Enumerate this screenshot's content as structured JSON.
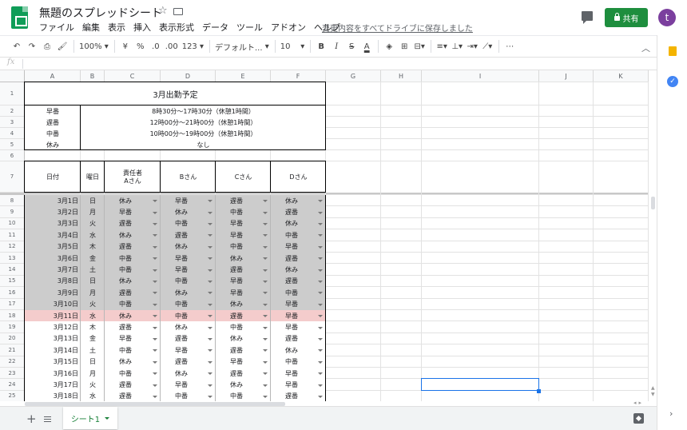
{
  "app": {
    "title": "無題のスプレッドシート",
    "save_status": "変更内容をすべてドライブに保存しました",
    "share_label": "共有",
    "avatar_letter": "t"
  },
  "menu": [
    "ファイル",
    "編集",
    "表示",
    "挿入",
    "表示形式",
    "データ",
    "ツール",
    "アドオン",
    "ヘルプ"
  ],
  "toolbar": {
    "zoom": "100%",
    "currency": "¥",
    "percent": "%",
    "dec_less": ".0",
    "dec_more": ".00",
    "more_formats": "123",
    "font": "デフォルト...",
    "font_size": "10",
    "bold": "B",
    "italic": "I",
    "strike": "S",
    "text_color": "A"
  },
  "formula_bar": {
    "fx": "fx",
    "value": ""
  },
  "columns": [
    "A",
    "B",
    "C",
    "D",
    "E",
    "F",
    "G",
    "H",
    "I",
    "J",
    "K"
  ],
  "rows": [
    "1",
    "2",
    "3",
    "4",
    "5",
    "6",
    "7",
    "8",
    "9",
    "10",
    "11",
    "12",
    "13",
    "14",
    "15",
    "16",
    "17",
    "18",
    "19",
    "20",
    "21",
    "22",
    "23",
    "24",
    "25"
  ],
  "sheet": {
    "title": "3月出勤予定",
    "shifts": [
      {
        "name": "早番",
        "time": "8時30分～17時30分（休憩1時間）"
      },
      {
        "name": "遅番",
        "time": "12時00分～21時00分（休憩1時間）"
      },
      {
        "name": "中番",
        "time": "10時00分～19時00分（休憩1時間）"
      },
      {
        "name": "休み",
        "time": "なし"
      }
    ],
    "headers": [
      "日付",
      "曜日",
      "責任者\nAさん",
      "Bさん",
      "Cさん",
      "Dさん"
    ],
    "schedule": [
      {
        "date": "3月1日",
        "day": "日",
        "a": "休み",
        "b": "早番",
        "c": "遅番",
        "d": "休み"
      },
      {
        "date": "3月2日",
        "day": "月",
        "a": "早番",
        "b": "休み",
        "c": "中番",
        "d": "遅番"
      },
      {
        "date": "3月3日",
        "day": "火",
        "a": "遅番",
        "b": "中番",
        "c": "早番",
        "d": "休み"
      },
      {
        "date": "3月4日",
        "day": "水",
        "a": "休み",
        "b": "遅番",
        "c": "早番",
        "d": "中番"
      },
      {
        "date": "3月5日",
        "day": "木",
        "a": "遅番",
        "b": "休み",
        "c": "中番",
        "d": "早番"
      },
      {
        "date": "3月6日",
        "day": "金",
        "a": "中番",
        "b": "早番",
        "c": "休み",
        "d": "遅番"
      },
      {
        "date": "3月7日",
        "day": "土",
        "a": "中番",
        "b": "早番",
        "c": "遅番",
        "d": "休み"
      },
      {
        "date": "3月8日",
        "day": "日",
        "a": "休み",
        "b": "中番",
        "c": "早番",
        "d": "遅番"
      },
      {
        "date": "3月9日",
        "day": "月",
        "a": "遅番",
        "b": "休み",
        "c": "早番",
        "d": "中番"
      },
      {
        "date": "3月10日",
        "day": "火",
        "a": "中番",
        "b": "中番",
        "c": "休み",
        "d": "早番"
      },
      {
        "date": "3月11日",
        "day": "水",
        "a": "休み",
        "b": "中番",
        "c": "遅番",
        "d": "早番"
      },
      {
        "date": "3月12日",
        "day": "木",
        "a": "遅番",
        "b": "休み",
        "c": "中番",
        "d": "早番"
      },
      {
        "date": "3月13日",
        "day": "金",
        "a": "早番",
        "b": "遅番",
        "c": "休み",
        "d": "遅番"
      },
      {
        "date": "3月14日",
        "day": "土",
        "a": "中番",
        "b": "早番",
        "c": "遅番",
        "d": "休み"
      },
      {
        "date": "3月15日",
        "day": "日",
        "a": "休み",
        "b": "遅番",
        "c": "早番",
        "d": "中番"
      },
      {
        "date": "3月16日",
        "day": "月",
        "a": "中番",
        "b": "休み",
        "c": "遅番",
        "d": "早番"
      },
      {
        "date": "3月17日",
        "day": "火",
        "a": "遅番",
        "b": "早番",
        "c": "休み",
        "d": "早番"
      },
      {
        "date": "3月18日",
        "day": "水",
        "a": "遅番",
        "b": "中番",
        "c": "中番",
        "d": "遅番"
      }
    ]
  },
  "sheet_tab": "シート1",
  "colors": {
    "gray_fill": "#cccccc",
    "highlight_fill": "#f4cccc",
    "selection": "#1a73e8",
    "share_green": "#1e8e3e"
  }
}
